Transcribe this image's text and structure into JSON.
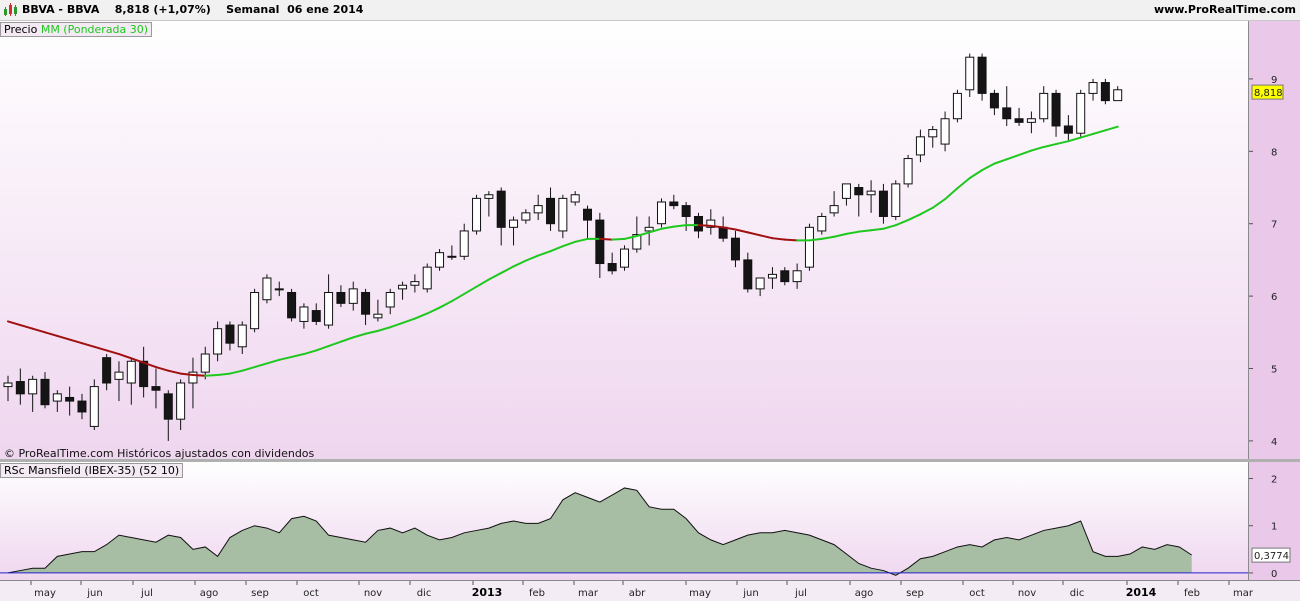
{
  "header": {
    "ticker": "BBVA - BBVA",
    "price_change": "8,818 (+1,07%)",
    "period_date": "Semanal  06 ene 2014",
    "website": "www.ProRealTime.com"
  },
  "colors": {
    "plot_background_top": "#ffffff",
    "plot_background_bottom": "#efd6ef",
    "axis_background": "#e9c8e9",
    "ma_rising": "#1ec81e",
    "ma_falling": "#a01010",
    "rsc_fill": "#a7bda4",
    "zero_line": "#2222cc",
    "candle_down": "#151515",
    "candle_up": "#ffffff"
  },
  "legend": {
    "price_label": "Precio",
    "ma_label": "MM (Ponderada 30)",
    "indicator_label": "RSc Mansfield (IBEX-35) (52 10)"
  },
  "copyright": "© ProRealTime.com  Históricos ajustados con dividendos",
  "chart_data": [
    {
      "type": "candlestick",
      "title": "BBVA - BBVA",
      "timeframe": "Semanal",
      "y_ticks": [
        "4",
        "5",
        "6",
        "7",
        "8",
        "9"
      ],
      "ylim": [
        3.75,
        9.8
      ],
      "last_price_label": "8,818",
      "last_price": 8.818,
      "candles": [
        [
          4.75,
          4.9,
          4.55,
          4.8
        ],
        [
          4.82,
          5.0,
          4.5,
          4.65
        ],
        [
          4.65,
          4.9,
          4.4,
          4.85
        ],
        [
          4.85,
          4.95,
          4.45,
          4.5
        ],
        [
          4.55,
          4.7,
          4.4,
          4.65
        ],
        [
          4.6,
          4.75,
          4.35,
          4.55
        ],
        [
          4.55,
          4.65,
          4.3,
          4.4
        ],
        [
          4.2,
          4.85,
          4.15,
          4.75
        ],
        [
          5.15,
          5.2,
          4.7,
          4.8
        ],
        [
          4.85,
          5.1,
          4.55,
          4.95
        ],
        [
          4.8,
          5.15,
          4.5,
          5.1
        ],
        [
          5.1,
          5.3,
          4.6,
          4.75
        ],
        [
          4.75,
          5.0,
          4.45,
          4.7
        ],
        [
          4.65,
          4.7,
          4.0,
          4.3
        ],
        [
          4.3,
          4.85,
          4.15,
          4.8
        ],
        [
          4.8,
          5.15,
          4.45,
          4.95
        ],
        [
          4.95,
          5.3,
          4.85,
          5.2
        ],
        [
          5.2,
          5.65,
          5.1,
          5.55
        ],
        [
          5.6,
          5.65,
          5.25,
          5.35
        ],
        [
          5.3,
          5.65,
          5.2,
          5.6
        ],
        [
          5.55,
          6.1,
          5.5,
          6.05
        ],
        [
          5.95,
          6.3,
          5.9,
          6.25
        ],
        [
          6.1,
          6.2,
          6.0,
          6.1
        ],
        [
          6.05,
          6.1,
          5.65,
          5.7
        ],
        [
          5.65,
          5.9,
          5.55,
          5.85
        ],
        [
          5.8,
          5.9,
          5.6,
          5.65
        ],
        [
          5.6,
          6.3,
          5.55,
          6.05
        ],
        [
          6.05,
          6.15,
          5.85,
          5.9
        ],
        [
          5.9,
          6.2,
          5.8,
          6.1
        ],
        [
          6.05,
          6.1,
          5.6,
          5.75
        ],
        [
          5.7,
          5.95,
          5.65,
          5.75
        ],
        [
          5.85,
          6.1,
          5.75,
          6.05
        ],
        [
          6.1,
          6.2,
          5.95,
          6.15
        ],
        [
          6.15,
          6.3,
          6.05,
          6.2
        ],
        [
          6.1,
          6.45,
          6.05,
          6.4
        ],
        [
          6.4,
          6.65,
          6.35,
          6.6
        ],
        [
          6.55,
          6.7,
          6.5,
          6.55
        ],
        [
          6.55,
          7.0,
          6.5,
          6.9
        ],
        [
          6.9,
          7.4,
          6.85,
          7.35
        ],
        [
          7.35,
          7.45,
          7.1,
          7.4
        ],
        [
          7.45,
          7.5,
          6.7,
          6.95
        ],
        [
          6.95,
          7.1,
          6.7,
          7.05
        ],
        [
          7.05,
          7.2,
          7.0,
          7.15
        ],
        [
          7.15,
          7.4,
          7.05,
          7.25
        ],
        [
          7.35,
          7.5,
          6.9,
          7.0
        ],
        [
          6.9,
          7.4,
          6.8,
          7.35
        ],
        [
          7.3,
          7.45,
          7.25,
          7.4
        ],
        [
          7.2,
          7.25,
          6.8,
          7.05
        ],
        [
          7.05,
          7.15,
          6.25,
          6.45
        ],
        [
          6.45,
          6.6,
          6.3,
          6.35
        ],
        [
          6.4,
          6.7,
          6.35,
          6.65
        ],
        [
          6.65,
          7.1,
          6.6,
          6.85
        ],
        [
          6.9,
          7.1,
          6.7,
          6.95
        ],
        [
          7.0,
          7.35,
          6.95,
          7.3
        ],
        [
          7.3,
          7.4,
          7.2,
          7.25
        ],
        [
          7.25,
          7.3,
          6.9,
          7.1
        ],
        [
          7.1,
          7.15,
          6.8,
          6.9
        ],
        [
          6.95,
          7.2,
          6.85,
          7.05
        ],
        [
          6.95,
          7.1,
          6.75,
          6.8
        ],
        [
          6.8,
          6.9,
          6.4,
          6.5
        ],
        [
          6.5,
          6.6,
          6.05,
          6.1
        ],
        [
          6.1,
          6.25,
          6.0,
          6.25
        ],
        [
          6.25,
          6.4,
          6.1,
          6.3
        ],
        [
          6.35,
          6.4,
          6.15,
          6.2
        ],
        [
          6.2,
          6.45,
          6.1,
          6.35
        ],
        [
          6.4,
          7.0,
          6.35,
          6.95
        ],
        [
          6.9,
          7.15,
          6.85,
          7.1
        ],
        [
          7.15,
          7.45,
          7.1,
          7.25
        ],
        [
          7.35,
          7.55,
          7.25,
          7.55
        ],
        [
          7.5,
          7.55,
          7.1,
          7.4
        ],
        [
          7.4,
          7.6,
          7.15,
          7.45
        ],
        [
          7.45,
          7.55,
          7.0,
          7.1
        ],
        [
          7.1,
          7.6,
          7.05,
          7.55
        ],
        [
          7.55,
          7.95,
          7.5,
          7.9
        ],
        [
          7.95,
          8.3,
          7.85,
          8.2
        ],
        [
          8.2,
          8.35,
          8.05,
          8.3
        ],
        [
          8.1,
          8.55,
          8.0,
          8.45
        ],
        [
          8.45,
          8.85,
          8.4,
          8.8
        ],
        [
          8.85,
          9.35,
          8.75,
          9.3
        ],
        [
          9.3,
          9.35,
          8.7,
          8.8
        ],
        [
          8.8,
          8.85,
          8.5,
          8.6
        ],
        [
          8.6,
          8.9,
          8.35,
          8.45
        ],
        [
          8.45,
          8.6,
          8.35,
          8.4
        ],
        [
          8.4,
          8.55,
          8.25,
          8.45
        ],
        [
          8.45,
          8.9,
          8.4,
          8.8
        ],
        [
          8.8,
          8.85,
          8.2,
          8.35
        ],
        [
          8.35,
          8.5,
          8.15,
          8.25
        ],
        [
          8.25,
          8.85,
          8.2,
          8.8
        ],
        [
          8.8,
          9.0,
          8.7,
          8.95
        ],
        [
          8.95,
          9.0,
          8.65,
          8.7
        ],
        [
          8.7,
          8.9,
          8.7,
          8.85
        ]
      ],
      "moving_average": {
        "name": "MM (Ponderada 30)",
        "values": [
          5.65,
          5.6,
          5.55,
          5.5,
          5.45,
          5.4,
          5.35,
          5.3,
          5.25,
          5.2,
          5.14,
          5.08,
          5.02,
          4.97,
          4.93,
          4.91,
          4.9,
          4.91,
          4.93,
          4.97,
          5.02,
          5.07,
          5.12,
          5.16,
          5.2,
          5.25,
          5.31,
          5.37,
          5.43,
          5.48,
          5.52,
          5.57,
          5.63,
          5.69,
          5.76,
          5.84,
          5.93,
          6.03,
          6.13,
          6.23,
          6.32,
          6.41,
          6.49,
          6.56,
          6.62,
          6.69,
          6.75,
          6.79,
          6.79,
          6.78,
          6.79,
          6.83,
          6.88,
          6.93,
          6.96,
          6.98,
          6.98,
          6.97,
          6.95,
          6.92,
          6.88,
          6.84,
          6.8,
          6.78,
          6.77,
          6.77,
          6.79,
          6.82,
          6.86,
          6.89,
          6.91,
          6.93,
          6.98,
          7.05,
          7.13,
          7.22,
          7.34,
          7.49,
          7.63,
          7.74,
          7.83,
          7.89,
          7.95,
          8.01,
          8.06,
          8.1,
          8.14,
          8.19,
          8.24,
          8.29,
          8.34
        ]
      }
    },
    {
      "type": "area",
      "title": "RSc Mansfield (IBEX-35) (52 10)",
      "y_ticks": [
        "0",
        "1",
        "2"
      ],
      "ylim": [
        -0.15,
        2.35
      ],
      "last_value_label": "0,3774",
      "last_value": 0.3774,
      "values": [
        0.0,
        0.05,
        0.1,
        0.1,
        0.35,
        0.4,
        0.45,
        0.45,
        0.6,
        0.8,
        0.75,
        0.7,
        0.65,
        0.8,
        0.75,
        0.5,
        0.55,
        0.35,
        0.75,
        0.9,
        1.0,
        0.95,
        0.85,
        1.15,
        1.2,
        1.1,
        0.8,
        0.75,
        0.7,
        0.65,
        0.9,
        0.95,
        0.85,
        0.95,
        0.8,
        0.7,
        0.75,
        0.85,
        0.9,
        0.95,
        1.05,
        1.1,
        1.05,
        1.05,
        1.15,
        1.55,
        1.7,
        1.6,
        1.5,
        1.65,
        1.8,
        1.75,
        1.4,
        1.35,
        1.35,
        1.15,
        0.85,
        0.7,
        0.6,
        0.7,
        0.8,
        0.85,
        0.85,
        0.9,
        0.85,
        0.8,
        0.7,
        0.6,
        0.4,
        0.2,
        0.1,
        0.05,
        -0.05,
        0.1,
        0.3,
        0.35,
        0.45,
        0.55,
        0.6,
        0.55,
        0.7,
        0.75,
        0.7,
        0.8,
        0.9,
        0.95,
        1.0,
        1.1,
        0.45,
        0.35,
        0.35,
        0.4,
        0.55,
        0.5,
        0.6,
        0.55,
        0.38
      ]
    }
  ],
  "x_axis": {
    "labels": [
      "may",
      "jun",
      "jul",
      "ago",
      "sep",
      "oct",
      "nov",
      "dic",
      "2013",
      "feb",
      "mar",
      "abr",
      "may",
      "jun",
      "jul",
      "ago",
      "sep",
      "oct",
      "nov",
      "dic",
      "2014",
      "feb",
      "mar"
    ],
    "bold_labels": [
      "2013",
      "2014"
    ]
  }
}
